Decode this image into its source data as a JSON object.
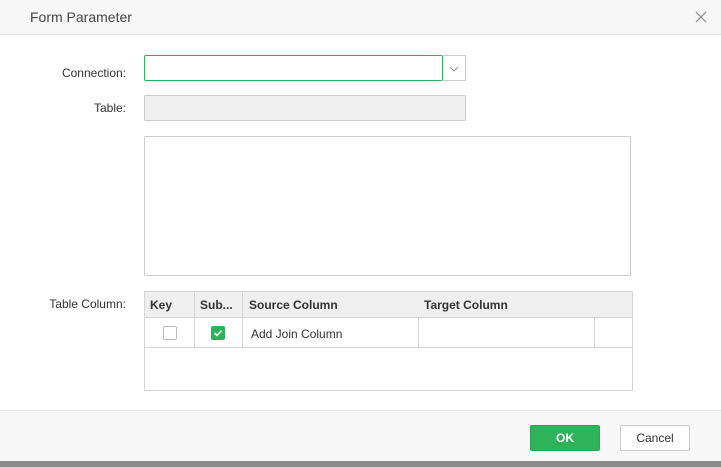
{
  "dialog": {
    "title": "Form Parameter"
  },
  "form": {
    "connection_label": "Connection:",
    "connection_value": "",
    "table_label": "Table:",
    "table_value": "",
    "table_column_label": "Table Column:"
  },
  "grid": {
    "columns": [
      "Key",
      "Sub...",
      "Source Column",
      "Target Column"
    ],
    "rows": [
      {
        "key_checked": false,
        "sub_checked": true,
        "source": "Add Join Column",
        "target": ""
      }
    ]
  },
  "footer": {
    "ok_label": "OK",
    "cancel_label": "Cancel"
  },
  "colors": {
    "accent": "#2fb35a",
    "header_bg": "#f7f7f7",
    "grid_header_bg": "#efefef"
  },
  "icons": {
    "close": "close-icon",
    "dropdown": "chevron-down-icon",
    "checkmark": "check-icon"
  }
}
